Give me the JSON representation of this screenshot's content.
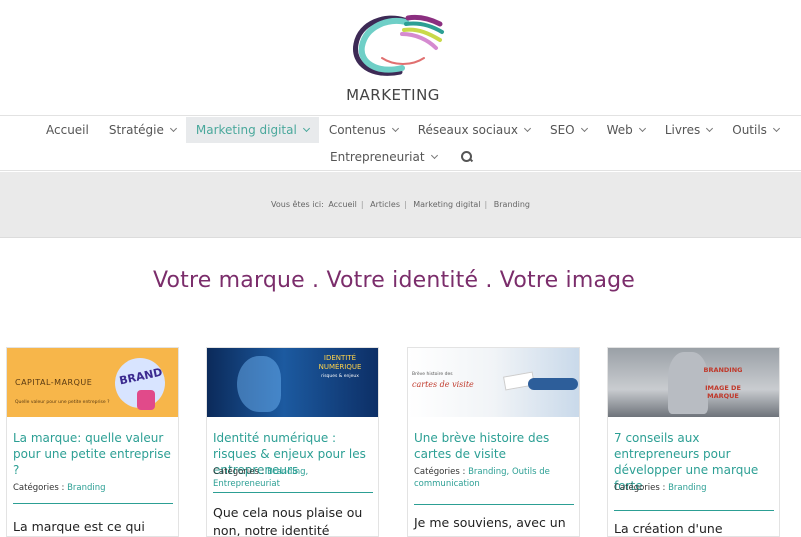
{
  "brand": {
    "logo_text": "MARKETING"
  },
  "nav": {
    "row1": [
      {
        "label": "Accueil",
        "has_dropdown": false
      },
      {
        "label": "Stratégie",
        "has_dropdown": true
      },
      {
        "label": "Marketing digital",
        "has_dropdown": true,
        "active": true
      },
      {
        "label": "Contenus",
        "has_dropdown": true
      },
      {
        "label": "Réseaux sociaux",
        "has_dropdown": true
      },
      {
        "label": "SEO",
        "has_dropdown": true
      },
      {
        "label": "Web",
        "has_dropdown": true
      },
      {
        "label": "Livres",
        "has_dropdown": true
      },
      {
        "label": "Outils",
        "has_dropdown": true
      }
    ],
    "row2": [
      {
        "label": "Entrepreneuriat",
        "has_dropdown": true
      }
    ]
  },
  "breadcrumb": {
    "prefix": "Vous êtes ici:",
    "items": [
      "Accueil",
      "Articles",
      "Marketing digital",
      "Branding"
    ]
  },
  "headline": "Votre marque . Votre identité . Votre image",
  "cards": [
    {
      "image_caption": "CAPITAL-MARQUE",
      "image_sub": "Quelle valeur pour une petite entreprise ?",
      "image_badge": "BRAND",
      "title": "La marque: quelle valeur pour une petite entreprise ?",
      "cats_label": "Catégories :",
      "cats": "Branding",
      "excerpt": "La marque est ce qui"
    },
    {
      "image_caption": "IDENTITÉ NUMÉRIQUE",
      "image_sub": "risques & enjeux",
      "title": "Identité numérique : risques & enjeux pour les entrepreneurs",
      "cats_label": "Catégories :",
      "cats": "Branding, Entrepreneuriat",
      "excerpt": "Que cela nous plaise ou non, notre identité numérique est"
    },
    {
      "image_caption": "Brève histoire des",
      "image_sub": "cartes de visite",
      "title": "Une brève histoire des cartes de visite",
      "cats_label": "Catégories :",
      "cats": "Branding, Outils de communication",
      "excerpt": "Je me souviens, avec un"
    },
    {
      "image_caption": "BRANDING",
      "image_sub": "IMAGE DE MARQUE",
      "title": "7 conseils aux entrepreneurs pour développer une marque forte",
      "cats_label": "Catégories :",
      "cats": "Branding",
      "excerpt": "La création d'une entreprise"
    }
  ],
  "colors": {
    "accent": "#2c9f94",
    "headline": "#7b2d6b",
    "nav_active_bg": "#e8eaec"
  }
}
